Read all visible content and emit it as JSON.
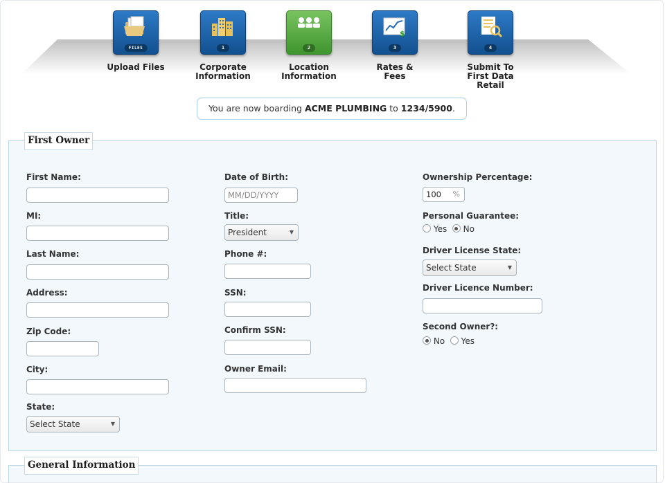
{
  "wizard": {
    "steps": [
      {
        "label": "Upload Files",
        "badge": "FILES",
        "icon": "files-icon"
      },
      {
        "label": "Corporate\nInformation",
        "badge": "1",
        "icon": "buildings-icon"
      },
      {
        "label": "Location\nInformation",
        "badge": "2",
        "icon": "people-icon",
        "active": true
      },
      {
        "label": "Rates &\nFees",
        "badge": "3",
        "icon": "chart-icon"
      },
      {
        "label": "Submit To\nFirst Data Retail",
        "badge": "4",
        "icon": "document-search-icon"
      }
    ],
    "colors": {
      "step": "#1d62aa",
      "active_step": "#58ad44"
    }
  },
  "notice": {
    "prefix": "You are now boarding ",
    "merchant": "ACME PLUMBING",
    "middle": " to ",
    "account": "1234/5900",
    "suffix": "."
  },
  "first_owner": {
    "legend": "First Owner",
    "first_name": {
      "label": "First Name:",
      "value": ""
    },
    "mi": {
      "label": "MI:",
      "value": ""
    },
    "last_name": {
      "label": "Last Name:",
      "value": ""
    },
    "address": {
      "label": "Address:",
      "value": ""
    },
    "zip": {
      "label": "Zip Code:",
      "value": ""
    },
    "city": {
      "label": "City:",
      "value": ""
    },
    "state": {
      "label": "State:",
      "value": "Select State"
    },
    "dob": {
      "label": "Date of Birth:",
      "placeholder": "MM/DD/YYYY"
    },
    "title": {
      "label": "Title:",
      "value": "President"
    },
    "phone": {
      "label": "Phone #:",
      "value": ""
    },
    "ssn": {
      "label": "SSN:",
      "value": ""
    },
    "confirm_ssn": {
      "label": "Confirm SSN:",
      "value": ""
    },
    "email": {
      "label": "Owner Email:",
      "value": ""
    },
    "ownership": {
      "label": "Ownership Percentage:",
      "value": "100",
      "unit": "%"
    },
    "guarantee": {
      "label": "Personal Guarantee:",
      "yes": "Yes",
      "no": "No",
      "selected": "No"
    },
    "dl_state": {
      "label": "Driver License State:",
      "value": "Select State"
    },
    "dl_number": {
      "label": "Driver Licence Number:",
      "value": ""
    },
    "second_owner": {
      "label": "Second Owner?:",
      "no": "No",
      "yes": "Yes",
      "selected": "No"
    }
  },
  "general": {
    "legend": "General Information"
  }
}
